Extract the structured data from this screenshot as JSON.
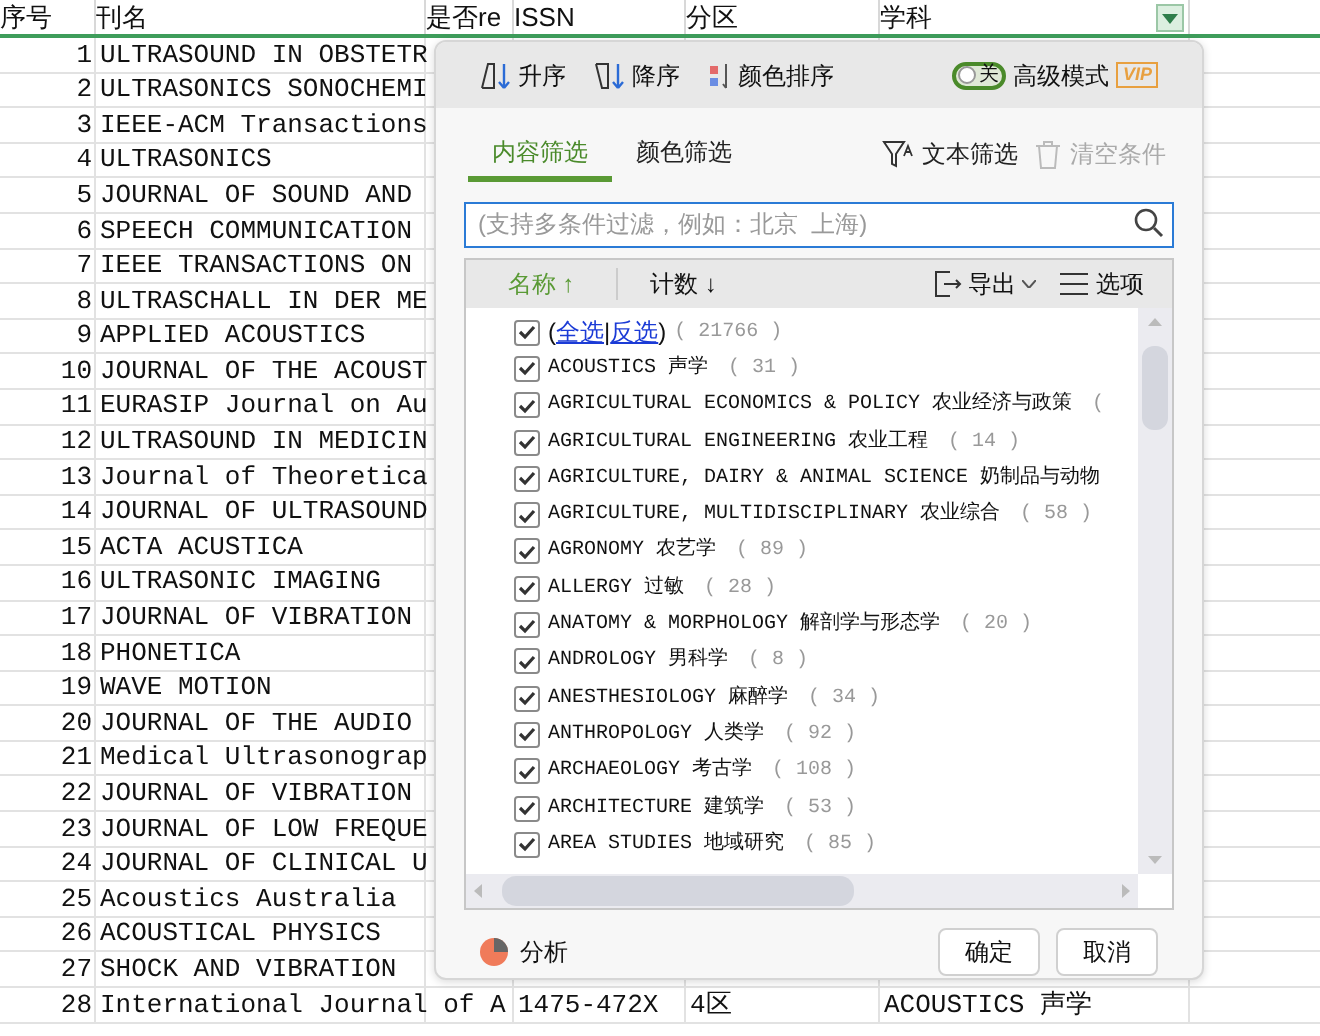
{
  "sheet": {
    "columns": [
      "序号",
      "刊名",
      "是否re",
      "ISSN",
      "分区",
      "学科"
    ],
    "rows": [
      {
        "no": "1",
        "name": "ULTRASOUND IN OBSTETR"
      },
      {
        "no": "2",
        "name": "ULTRASONICS SONOCHEMI"
      },
      {
        "no": "3",
        "name": "IEEE-ACM Transactions"
      },
      {
        "no": "4",
        "name": "ULTRASONICS"
      },
      {
        "no": "5",
        "name": "JOURNAL OF SOUND AND"
      },
      {
        "no": "6",
        "name": "SPEECH COMMUNICATION"
      },
      {
        "no": "7",
        "name": "IEEE TRANSACTIONS ON"
      },
      {
        "no": "8",
        "name": "ULTRASCHALL IN DER ME"
      },
      {
        "no": "9",
        "name": "APPLIED ACOUSTICS"
      },
      {
        "no": "10",
        "name": "JOURNAL OF THE ACOUST"
      },
      {
        "no": "11",
        "name": "EURASIP Journal on Au"
      },
      {
        "no": "12",
        "name": "ULTRASOUND IN MEDICIN"
      },
      {
        "no": "13",
        "name": "Journal of Theoretica"
      },
      {
        "no": "14",
        "name": "JOURNAL OF ULTRASOUND"
      },
      {
        "no": "15",
        "name": "ACTA ACUSTICA"
      },
      {
        "no": "16",
        "name": "ULTRASONIC IMAGING"
      },
      {
        "no": "17",
        "name": "JOURNAL OF VIBRATION"
      },
      {
        "no": "18",
        "name": "PHONETICA"
      },
      {
        "no": "19",
        "name": "WAVE MOTION"
      },
      {
        "no": "20",
        "name": "JOURNAL OF THE AUDIO"
      },
      {
        "no": "21",
        "name": "Medical Ultrasonograp"
      },
      {
        "no": "22",
        "name": "JOURNAL OF VIBRATION"
      },
      {
        "no": "23",
        "name": "JOURNAL OF LOW FREQUE"
      },
      {
        "no": "24",
        "name": "JOURNAL OF CLINICAL U"
      },
      {
        "no": "25",
        "name": "Acoustics Australia"
      },
      {
        "no": "26",
        "name": "ACOUSTICAL PHYSICS"
      },
      {
        "no": "27",
        "name": "SHOCK AND VIBRATION"
      },
      {
        "no": "28",
        "name": "International Journal of A",
        "issn": "1475-472X",
        "zone": "4区",
        "subject": "ACOUSTICS 声学"
      }
    ]
  },
  "dialog": {
    "sort_buttons": [
      {
        "kind": "asc",
        "label": "升序"
      },
      {
        "kind": "desc",
        "label": "降序"
      },
      {
        "kind": "color",
        "label": "颜色排序"
      }
    ],
    "advanced_mode": {
      "on": false,
      "switch_text": "关",
      "label": "高级模式",
      "badge": "VIP"
    },
    "tabs": [
      {
        "label": "内容筛选",
        "selected": true
      },
      {
        "label": "颜色筛选",
        "selected": false
      }
    ],
    "text_filter": {
      "label": "文本筛选",
      "disabled": false
    },
    "clear": {
      "label": "清空条件",
      "disabled": true
    },
    "search": {
      "placeholder": "(支持多条件过滤，例如：北京  上海)"
    },
    "list_header": {
      "name": "名称",
      "name_arrow": "↑",
      "count": "计数",
      "count_arrow": "↓",
      "export": "导出",
      "options": "选项"
    },
    "select_all": {
      "checked": true,
      "open": "(",
      "all": "全选",
      "sep": "|",
      "invert": "反选",
      "close": ")",
      "count": "( 21766 )"
    },
    "items": [
      {
        "label": "ACOUSTICS 声学",
        "count": "( 31 )",
        "checked": true
      },
      {
        "label": "AGRICULTURAL ECONOMICS & POLICY 农业经济与政策",
        "count": "(",
        "checked": true
      },
      {
        "label": "AGRICULTURAL ENGINEERING 农业工程",
        "count": "( 14 )",
        "checked": true
      },
      {
        "label": "AGRICULTURE, DAIRY & ANIMAL SCIENCE 奶制品与动物",
        "checked": true
      },
      {
        "label": "AGRICULTURE, MULTIDISCIPLINARY 农业综合",
        "count": "( 58 )",
        "checked": true
      },
      {
        "label": "AGRONOMY 农艺学",
        "count": "( 89 )",
        "checked": true
      },
      {
        "label": "ALLERGY 过敏",
        "count": "( 28 )",
        "checked": true
      },
      {
        "label": "ANATOMY & MORPHOLOGY 解剖学与形态学",
        "count": "( 20 )",
        "checked": true
      },
      {
        "label": "ANDROLOGY 男科学",
        "count": "( 8 )",
        "checked": true
      },
      {
        "label": "ANESTHESIOLOGY 麻醉学",
        "count": "( 34 )",
        "checked": true
      },
      {
        "label": "ANTHROPOLOGY 人类学",
        "count": "( 92 )",
        "checked": true
      },
      {
        "label": "ARCHAEOLOGY 考古学",
        "count": "( 108 )",
        "checked": true
      },
      {
        "label": "ARCHITECTURE 建筑学",
        "count": "( 53 )",
        "checked": true
      },
      {
        "label": "AREA STUDIES 地域研究",
        "count": "( 85 )",
        "checked": true
      }
    ],
    "analyze": "分析",
    "buttons": [
      "确定",
      "取消"
    ]
  }
}
